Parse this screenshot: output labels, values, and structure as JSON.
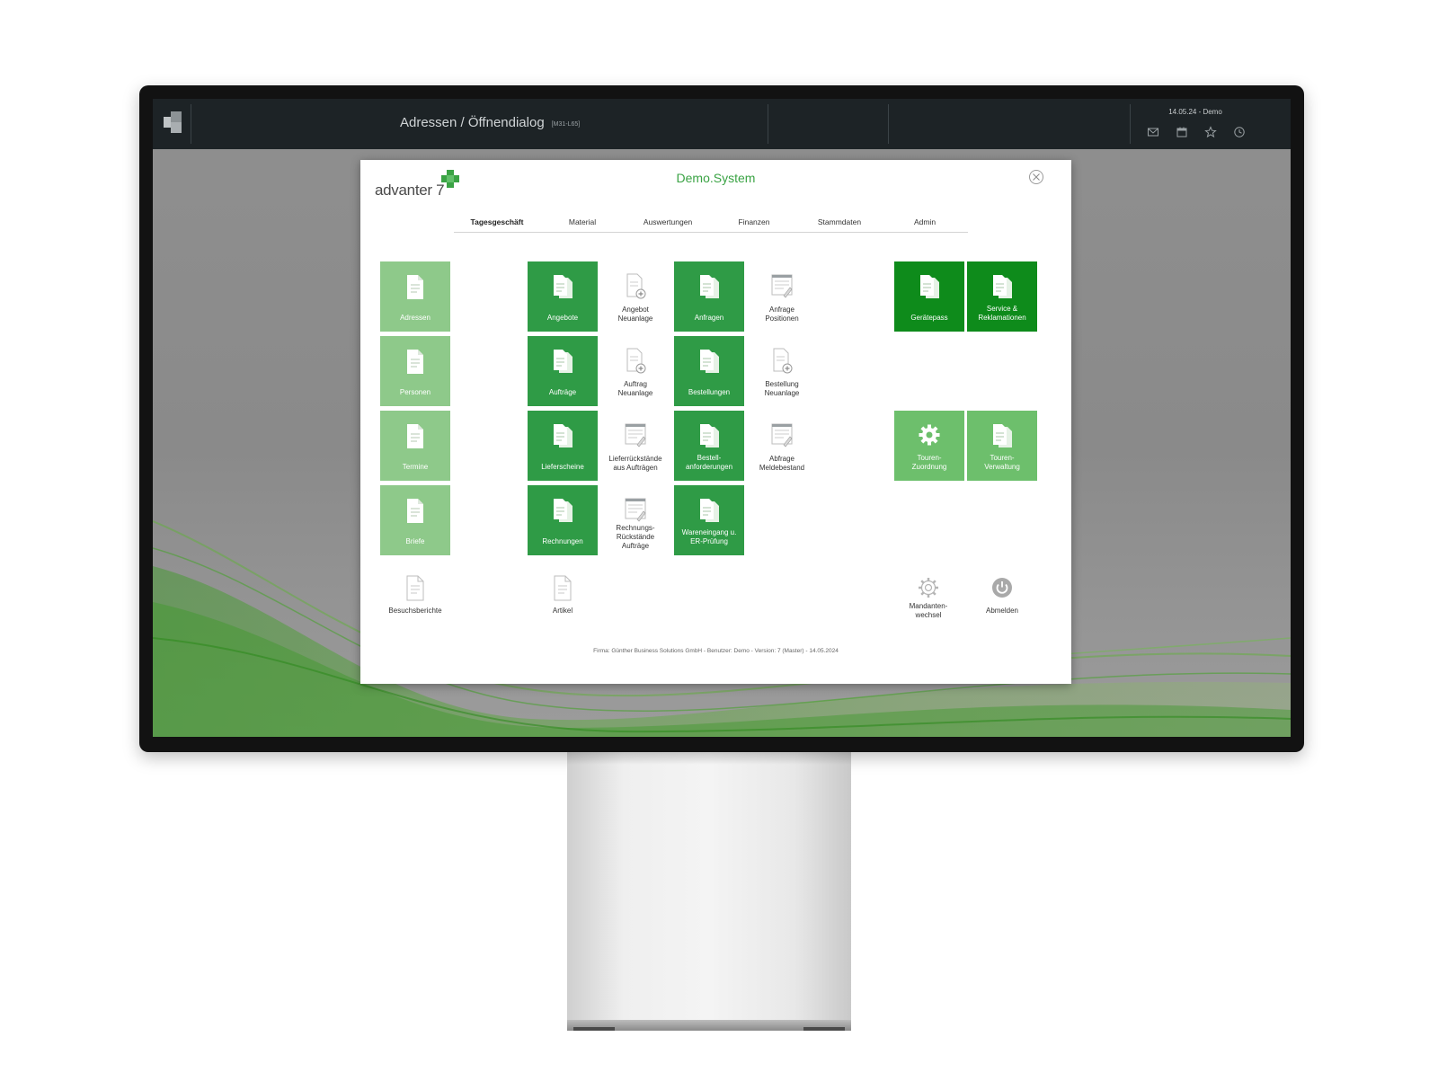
{
  "topbar": {
    "title": "Adressen / Öffnendialog",
    "code": "[M31-L65]",
    "date": "14.05.24 - Demo",
    "icons": [
      "mail-icon",
      "calendar-icon",
      "star-icon",
      "clock-icon"
    ]
  },
  "dialog": {
    "brand": "advanter 7",
    "system_title": "Demo.System",
    "tabs": [
      {
        "label": "Tagesgeschäft",
        "active": true
      },
      {
        "label": "Material"
      },
      {
        "label": "Auswertungen"
      },
      {
        "label": "Finanzen"
      },
      {
        "label": "Stammdaten"
      },
      {
        "label": "Admin"
      }
    ],
    "tiles": {
      "adressen": "Adressen",
      "personen": "Personen",
      "termine": "Termine",
      "briefe": "Briefe",
      "besuchsberichte": "Besuchsberichte",
      "angebote": "Angebote",
      "auftraege": "Aufträge",
      "lieferscheine": "Lieferscheine",
      "rechnungen": "Rechnungen",
      "artikel": "Artikel",
      "angebot_neu": "Angebot\nNeuanlage",
      "auftrag_neu": "Auftrag\nNeuanlage",
      "lieferrueck": "Lieferrückstände\naus Aufträgen",
      "rechnungsrueck": "Rechnungs-\nRückstände\nAufträge",
      "anfragen": "Anfragen",
      "bestellungen": "Bestellungen",
      "bestellanf": "Bestell-\nanforderungen",
      "wareneingang": "Wareneingang u.\nER-Prüfung",
      "anfrage_pos": "Anfrage\nPositionen",
      "bestellung_neu": "Bestellung\nNeuanlage",
      "abfrage_melde": "Abfrage\nMeldebestand",
      "geraetepass": "Gerätepass",
      "service": "Service &\nReklamationen",
      "touren_zuordnung": "Touren-\nZuordnung",
      "touren_verwaltung": "Touren-\nVerwaltung",
      "mandantenwechsel": "Mandanten-\nwechsel",
      "abmelden": "Abmelden"
    },
    "footer": "Firma: Günther Business Solutions GmbH - Benutzer: Demo - Version: 7 (Master) - 14.05.2024"
  },
  "colors": {
    "accent": "#3aa344",
    "tile_light": "#8ec98a",
    "tile_mid": "#2f9b46",
    "tile_strong": "#0e8b1b",
    "topbar": "#1d2326"
  }
}
